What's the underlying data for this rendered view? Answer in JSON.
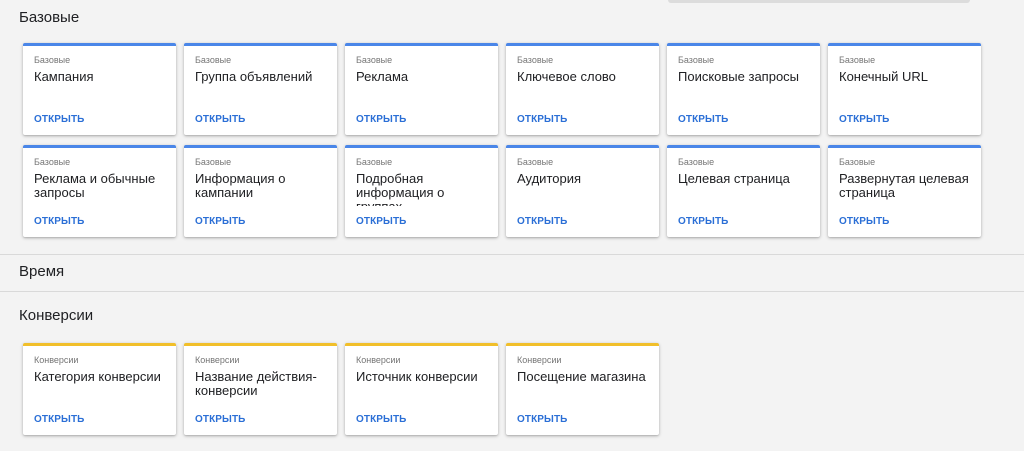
{
  "sections": {
    "basic": {
      "title": "Базовые",
      "cards": [
        {
          "category": "Базовые",
          "title": "Кампания",
          "action": "ОТКРЫТЬ"
        },
        {
          "category": "Базовые",
          "title": "Группа объявлений",
          "action": "ОТКРЫТЬ"
        },
        {
          "category": "Базовые",
          "title": "Реклама",
          "action": "ОТКРЫТЬ"
        },
        {
          "category": "Базовые",
          "title": "Ключевое слово",
          "action": "ОТКРЫТЬ"
        },
        {
          "category": "Базовые",
          "title": "Поисковые запросы",
          "action": "ОТКРЫТЬ"
        },
        {
          "category": "Базовые",
          "title": "Конечный URL",
          "action": "ОТКРЫТЬ"
        },
        {
          "category": "Базовые",
          "title": "Реклама и обычные запросы",
          "action": "ОТКРЫТЬ"
        },
        {
          "category": "Базовые",
          "title": "Информация о кампании",
          "action": "ОТКРЫТЬ"
        },
        {
          "category": "Базовые",
          "title": "Подробная информация о группах",
          "action": "ОТКРЫТЬ"
        },
        {
          "category": "Базовые",
          "title": "Аудитория",
          "action": "ОТКРЫТЬ"
        },
        {
          "category": "Базовые",
          "title": "Целевая страница",
          "action": "ОТКРЫТЬ"
        },
        {
          "category": "Базовые",
          "title": "Развернутая целевая страница",
          "action": "ОТКРЫТЬ"
        }
      ]
    },
    "time": {
      "title": "Время"
    },
    "conversions": {
      "title": "Конверсии",
      "cards": [
        {
          "category": "Конверсии",
          "title": "Категория конверсии",
          "action": "ОТКРЫТЬ"
        },
        {
          "category": "Конверсии",
          "title": "Название действия-конверсии",
          "action": "ОТКРЫТЬ"
        },
        {
          "category": "Конверсии",
          "title": "Источник конверсии",
          "action": "ОТКРЫТЬ"
        },
        {
          "category": "Конверсии",
          "title": "Посещение магазина",
          "action": "ОТКРЫТЬ"
        }
      ]
    }
  },
  "colors": {
    "basic_accent": "#4a86e8",
    "conversion_accent": "#f1bf2a",
    "link": "#2b6fd6",
    "background": "#f3f3f3"
  }
}
